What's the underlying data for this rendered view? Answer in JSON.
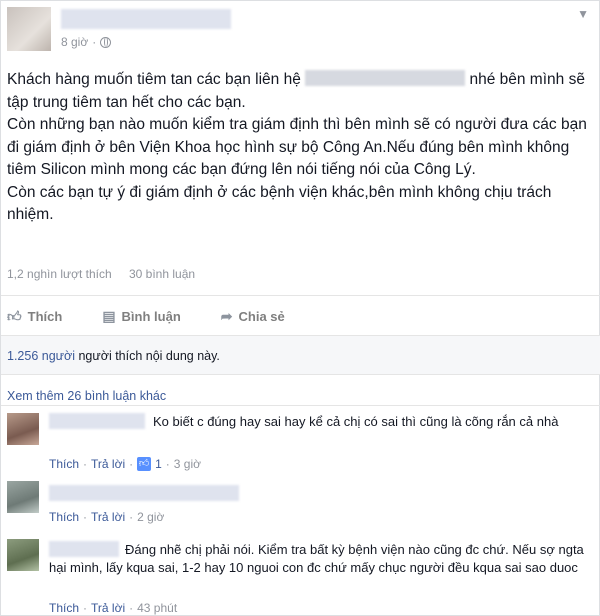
{
  "post": {
    "time": "8 giờ",
    "paragraphs": {
      "p1_before": "Khách hàng muốn tiêm tan các bạn liên hệ",
      "p1_after": "nhé bên mình sẽ tập trung tiêm tan hết cho các bạn.",
      "p2": "Còn những bạn nào muốn kiểm tra giám định thì bên mình sẽ có người đưa các bạn đi giám định ở bên Viện Khoa học hình sự bộ Công An.Nếu đúng bên mình không tiêm Silicon mình mong các bạn đứng lên nói tiếng nói của Công Lý.",
      "p3": "Còn các bạn tự ý đi giám định ở các bệnh viện khác,bên mình không chịu trách nhiệm."
    },
    "likes_count": "1,2 nghìn lượt thích",
    "comments_count": "30 bình luận"
  },
  "actions": {
    "like": "Thích",
    "comment": "Bình luận",
    "share": "Chia sẻ"
  },
  "likes_summary": {
    "count": "1.256 người",
    "text": "người thích nội dung này."
  },
  "more_comments": "Xem thêm 26 bình luận khác",
  "comments": [
    {
      "text": "Ko biết c đúng hay sai hay kể cả chị có sai thì cũng là cõng rắn cả nhà",
      "like": "Thích",
      "reply": "Trả lời",
      "like_count": "1",
      "time": "3 giờ"
    },
    {
      "text": "",
      "like": "Thích",
      "reply": "Trả lời",
      "time": "2 giờ"
    },
    {
      "text": "Đáng nhẽ chị phải nói. Kiểm tra bất kỳ bệnh viện nào cũng đc chứ. Nếu sợ ngta hại mình, lấy kqua sai, 1-2 hay 10 nguoi con đc chứ mấy chục người đều kqua sai sao duoc",
      "like": "Thích",
      "reply": "Trả lời",
      "time": "43 phút"
    }
  ]
}
